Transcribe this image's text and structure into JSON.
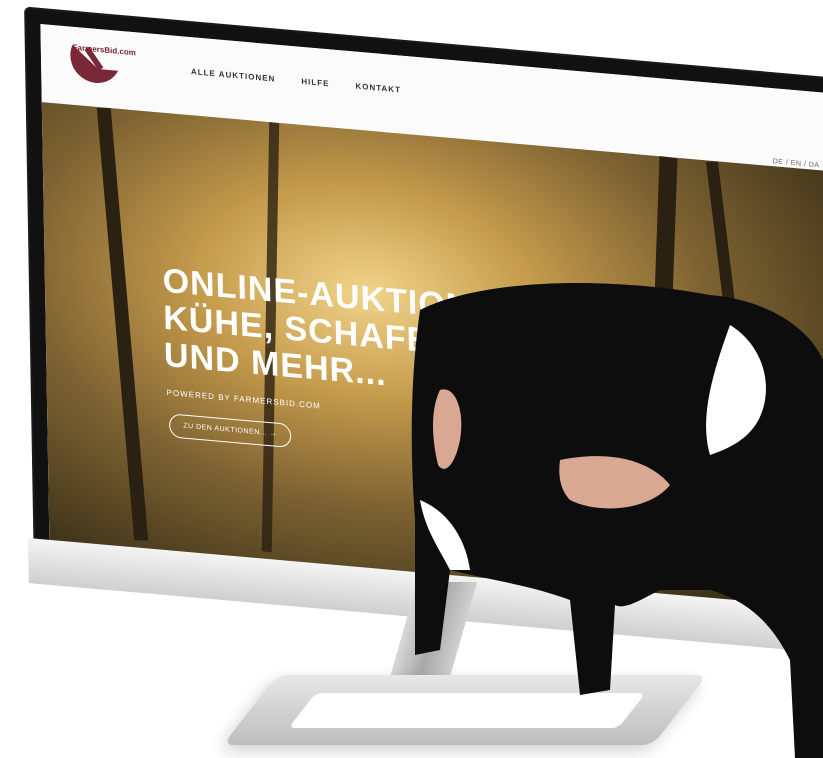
{
  "site": {
    "logo_text": "FarmersBid.com",
    "nav": [
      "ALLE AUKTIONEN",
      "HILFE",
      "KONTAKT"
    ],
    "languages": "DE / EN / DA"
  },
  "hero": {
    "title_lines": [
      "ONLINE-AUKTIONEN FÜR",
      "KÜHE, SCHAFE, SCHWEINE",
      "UND MEHR..."
    ],
    "subtitle": "POWERED BY FARMERSBID.COM",
    "cta": "ZU DEN AUKTIONEN... →"
  },
  "colors": {
    "brand": "#7a2738"
  }
}
